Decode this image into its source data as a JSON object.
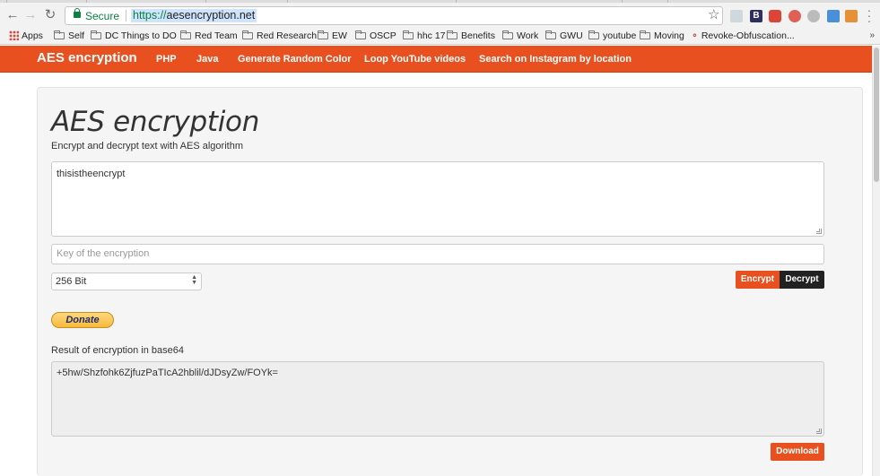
{
  "browser": {
    "secure_label": "Secure",
    "url_scheme": "https://",
    "url_host": "aesencryption.net",
    "extension_badge_b": "B"
  },
  "bookmarks": [
    {
      "label": "Apps",
      "type": "apps"
    },
    {
      "label": "Self",
      "type": "folder"
    },
    {
      "label": "DC Things to DO",
      "type": "folder"
    },
    {
      "label": "Red Team",
      "type": "folder"
    },
    {
      "label": "Red Research",
      "type": "folder"
    },
    {
      "label": "EW",
      "type": "folder"
    },
    {
      "label": "OSCP",
      "type": "folder"
    },
    {
      "label": "hhc 17",
      "type": "folder"
    },
    {
      "label": "Benefits",
      "type": "folder"
    },
    {
      "label": "Work",
      "type": "folder"
    },
    {
      "label": "GWU",
      "type": "folder"
    },
    {
      "label": "youtube",
      "type": "folder"
    },
    {
      "label": "Moving",
      "type": "folder"
    },
    {
      "label": "Revoke-Obfuscation...",
      "type": "link"
    }
  ],
  "bookmarks_overflow": "»",
  "site_nav": {
    "brand": "AES encryption",
    "links": [
      "PHP",
      "Java",
      "Generate Random Color",
      "Loop YouTube videos",
      "Search on Instagram by location"
    ]
  },
  "main": {
    "title": "AES encryption",
    "subtitle": "Encrypt and decrypt text with AES algorithm",
    "input_text": "thisistheencrypt",
    "key_placeholder": "Key of the encryption",
    "key_size_selected": "256 Bit",
    "encrypt_label": "Encrypt",
    "decrypt_label": "Decrypt",
    "donate_label": "Donate",
    "result_label": "Result of encryption in base64",
    "result_text": "+5hw/Shzfohk6ZjfuzPaTIcA2hblil/dJDsyZw/FOYk=",
    "download_label": "Download"
  },
  "colors": {
    "brand_orange": "#e8501f",
    "decrypt_dark": "#222222",
    "secure_green": "#0b8043"
  }
}
